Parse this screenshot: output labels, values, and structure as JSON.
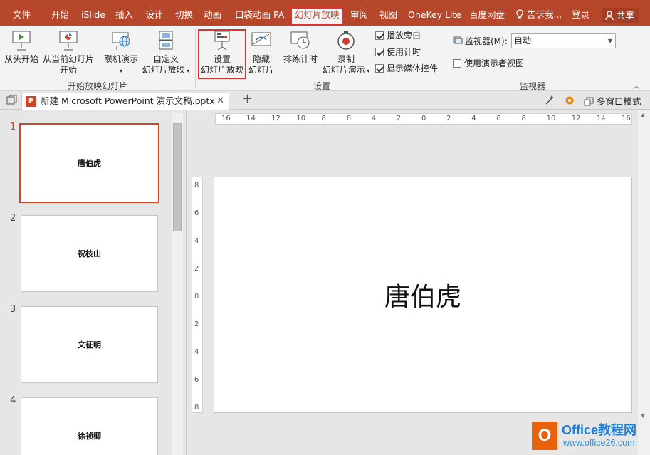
{
  "tabs": {
    "file": "文件",
    "home": "开始",
    "islide": "iSlide",
    "insert": "插入",
    "design": "设计",
    "transitions": "切换",
    "animations": "动画",
    "pocket": "口袋动画 PA",
    "slideshow": "幻灯片放映",
    "review": "审阅",
    "view": "视图",
    "onekey": "OneKey Lite",
    "baidu": "百度网盘",
    "tell": "告诉我...",
    "login": "登录",
    "share": "共享"
  },
  "ribbon": {
    "from_start": "从头开始",
    "from_current_1": "从当前幻灯片",
    "from_current_2": "开始",
    "online_present": "联机演示",
    "custom_1": "自定义",
    "custom_2": "幻灯片放映",
    "group_start": "开始放映幻灯片",
    "setup_1": "设置",
    "setup_2": "幻灯片放映",
    "hide_1": "隐藏",
    "hide_2": "幻灯片",
    "rehearse": "排练计时",
    "record_1": "录制",
    "record_2": "幻灯片演示",
    "play_narration": "播放旁白",
    "use_timings": "使用计时",
    "show_media": "显示媒体控件",
    "group_setup": "设置",
    "monitor_label": "监视器(M):",
    "monitor_value": "自动",
    "presenter_view": "使用演示者视图",
    "group_monitor": "监视器"
  },
  "checkboxes": {
    "play_narration": true,
    "use_timings": true,
    "show_media": true,
    "presenter_view": false
  },
  "doc": {
    "tab_title": "新建 Microsoft PowerPoint 演示文稿.pptx",
    "multiwindow": "多窗口模式"
  },
  "slides": [
    {
      "num": "1",
      "title": "唐伯虎"
    },
    {
      "num": "2",
      "title": "祝枝山"
    },
    {
      "num": "3",
      "title": "文征明"
    },
    {
      "num": "4",
      "title": "徐祯卿"
    }
  ],
  "current_slide_title": "唐伯虎",
  "ruler": {
    "h_ticks": [
      "16",
      "14",
      "12",
      "10",
      "8",
      "6",
      "4",
      "2",
      "0",
      "2",
      "4",
      "6",
      "8",
      "10",
      "12",
      "14",
      "16"
    ],
    "v_ticks": [
      "8",
      "6",
      "4",
      "2",
      "0",
      "2",
      "4",
      "6",
      "8"
    ]
  },
  "watermark": {
    "name": "Office教程网",
    "url": "www.office26.com"
  },
  "colors": {
    "accent": "#b7472a",
    "selection": "#d24726",
    "highlight": "#e03030"
  }
}
